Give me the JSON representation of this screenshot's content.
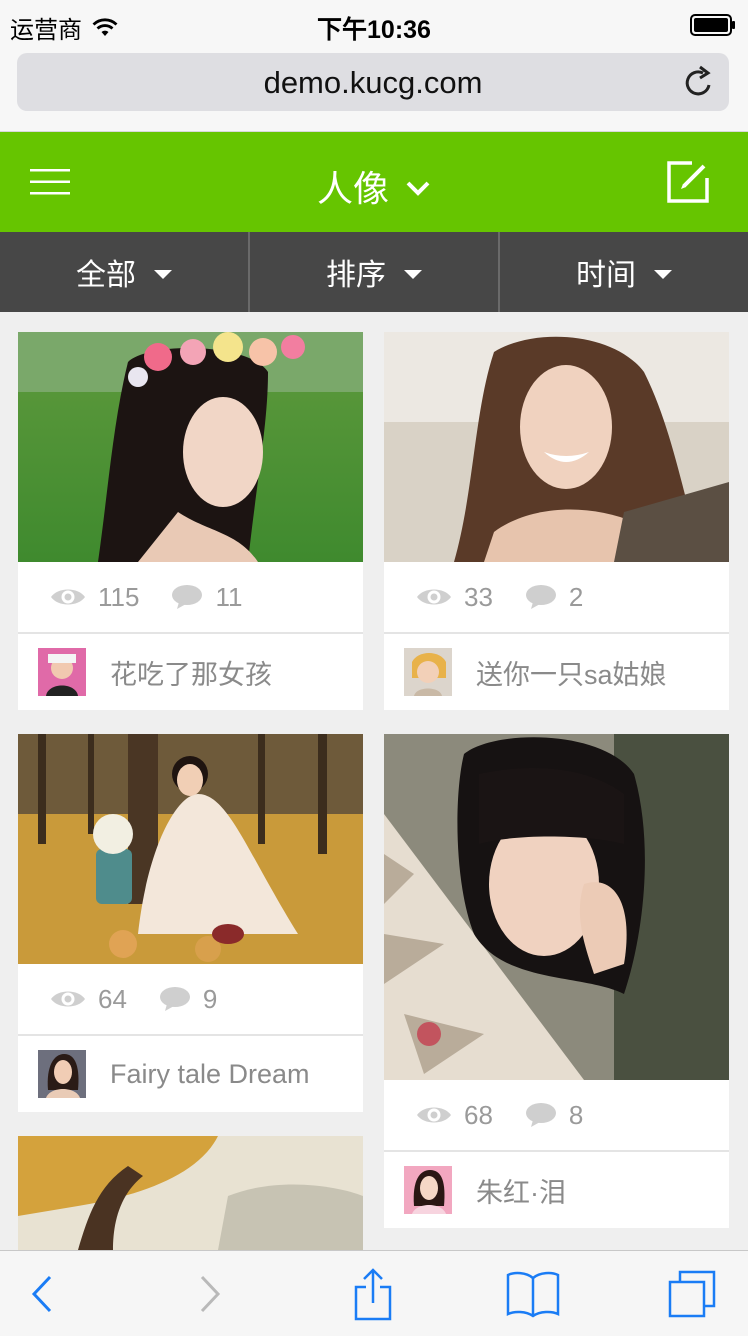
{
  "status_bar": {
    "carrier": "运营商",
    "time": "下午10:36"
  },
  "browser": {
    "url": "demo.kucg.com"
  },
  "header": {
    "title": "人像"
  },
  "filters": [
    {
      "label": "全部"
    },
    {
      "label": "排序"
    },
    {
      "label": "时间"
    }
  ],
  "posts": [
    {
      "views": "115",
      "comments": "11",
      "author": "花吃了那女孩"
    },
    {
      "views": "33",
      "comments": "2",
      "author": "送你一只sa姑娘"
    },
    {
      "views": "64",
      "comments": "9",
      "author": "Fairy tale Dream"
    },
    {
      "views": "68",
      "comments": "8",
      "author": "朱红·泪"
    }
  ],
  "colors": {
    "accent": "#66c500",
    "filter_bar": "#474747",
    "page_bg": "#efefef",
    "ios_blue": "#1a7cf5"
  }
}
